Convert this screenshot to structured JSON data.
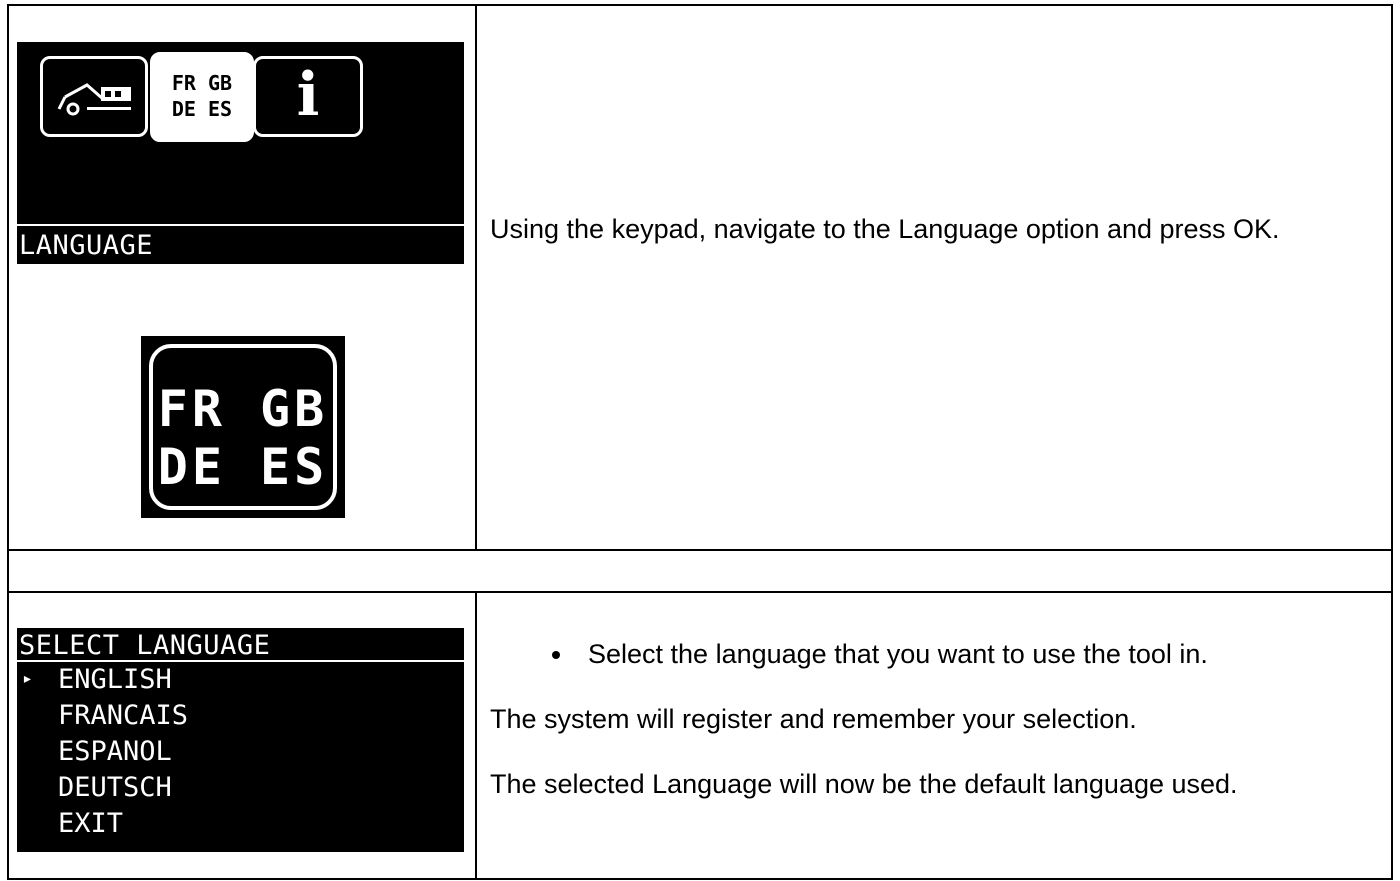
{
  "step1": {
    "menu_icons": [
      {
        "name": "vehicle-icon"
      },
      {
        "name": "language-icon",
        "lines": [
          "FR GB",
          "DE ES"
        ]
      },
      {
        "name": "info-icon",
        "glyph": "i"
      }
    ],
    "selected_label": "LANGUAGE",
    "big_icon_lines": [
      "FR GB",
      "DE ES"
    ],
    "instruction": "Using the keypad, navigate to the Language option and press OK."
  },
  "step2": {
    "screen_title": "SELECT LANGUAGE",
    "cursor_glyph": "▸",
    "options": [
      "ENGLISH",
      "FRANCAIS",
      "ESPANOL",
      "DEUTSCH",
      "EXIT"
    ],
    "bullet": "Select the language that you want to use the tool in.",
    "line1": "The system will register and remember your selection.",
    "line2": "The selected Language will now be the default language used."
  }
}
